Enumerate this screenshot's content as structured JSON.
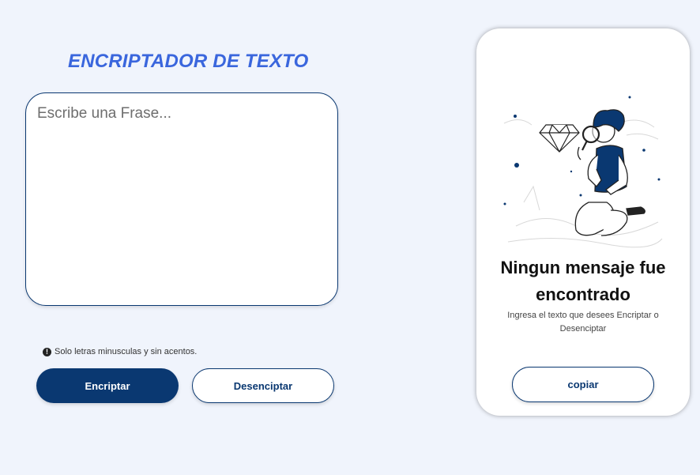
{
  "header": {
    "title": "ENCRIPTADOR DE TEXTO"
  },
  "input": {
    "placeholder": "Escribe una Frase...",
    "value": ""
  },
  "hint": {
    "icon": "exclamation-circle-icon",
    "text": "Solo letras minusculas y sin acentos."
  },
  "buttons": {
    "encrypt": "Encriptar",
    "decrypt": "Desenciptar",
    "copy": "copiar"
  },
  "output": {
    "illustration": "person-with-magnifier-illustration",
    "title": "Ningun mensaje fue encontrado",
    "subtitle": "Ingresa el texto que desees Encriptar o Desenciptar"
  },
  "colors": {
    "accent": "#0a3871",
    "title": "#3a66dd",
    "background": "#f0f4fc",
    "panel": "#ffffff"
  }
}
